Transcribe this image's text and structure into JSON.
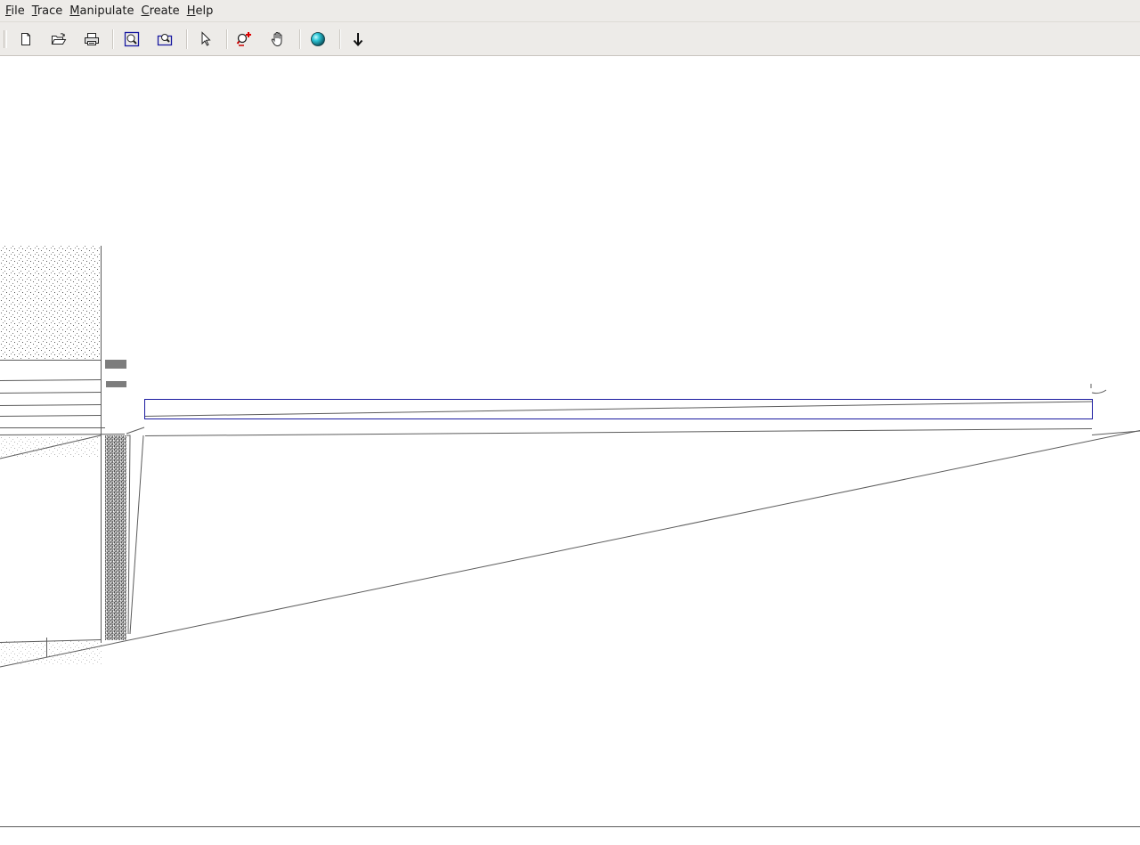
{
  "menubar": {
    "items": [
      {
        "first": "F",
        "rest": "ile"
      },
      {
        "first": "T",
        "rest": "race"
      },
      {
        "first": "M",
        "rest": "anipulate"
      },
      {
        "first": "C",
        "rest": "reate"
      },
      {
        "first": "H",
        "rest": "elp"
      }
    ]
  },
  "toolbar": {
    "buttons": [
      {
        "icon": "new-document-icon"
      },
      {
        "icon": "open-folder-icon"
      },
      {
        "icon": "print-icon"
      },
      {
        "icon": "zoom-extents-icon"
      },
      {
        "icon": "zoom-window-icon"
      },
      {
        "icon": "select-pointer-icon"
      },
      {
        "icon": "zoom-in-icon"
      },
      {
        "icon": "pan-hand-icon"
      },
      {
        "icon": "render-sphere-icon"
      },
      {
        "icon": "download-arrow-icon"
      }
    ]
  },
  "colors": {
    "chrome": "#edebe8",
    "drawing_lines": "#5c5c5c",
    "selection": "#1a1aa0",
    "background": "#ffffff"
  }
}
